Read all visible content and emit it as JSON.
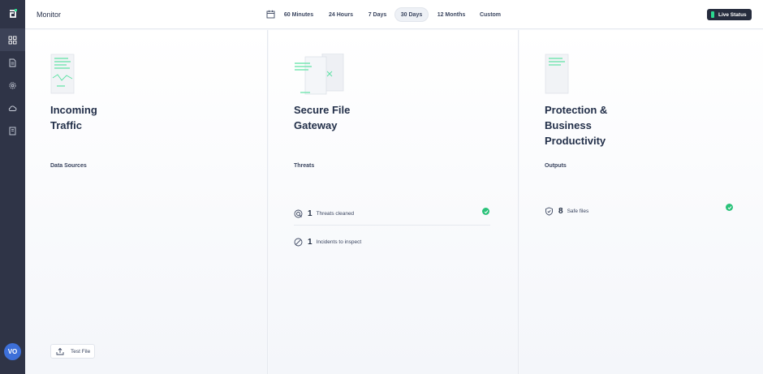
{
  "sidebar": {
    "logo_icon": "logo-icon",
    "items": [
      {
        "icon": "dashboard-grid-icon",
        "active": true
      },
      {
        "icon": "document-icon",
        "active": false
      },
      {
        "icon": "settings-gear-icon",
        "active": false
      },
      {
        "icon": "cloud-icon",
        "active": false
      },
      {
        "icon": "book-icon",
        "active": false
      }
    ],
    "avatar_initials": "VO"
  },
  "header": {
    "title": "Monitor",
    "calendar_icon": "calendar-icon",
    "ranges": [
      {
        "label": "60 Minutes",
        "active": false
      },
      {
        "label": "24 Hours",
        "active": false
      },
      {
        "label": "7 Days",
        "active": false
      },
      {
        "label": "30 Days",
        "active": true
      },
      {
        "label": "12 Months",
        "active": false
      },
      {
        "label": "Custom",
        "active": false
      }
    ],
    "live_status_label": "Live Status"
  },
  "columns": {
    "incoming": {
      "title_line1": "Incoming",
      "title_line2": "Traffic",
      "section": "Data Sources",
      "test_file_label": "Test File"
    },
    "gateway": {
      "title_line1": "Secure File",
      "title_line2": "Gateway",
      "section": "Threats",
      "stats": [
        {
          "value": "1",
          "label": "Threats cleaned",
          "icon": "virus-scan-icon"
        },
        {
          "value": "1",
          "label": "Incidents to inspect",
          "icon": "blocked-icon"
        }
      ]
    },
    "protection": {
      "title_line1": "Protection &",
      "title_line2": "Business",
      "title_line3": "Productivity",
      "section": "Outputs",
      "stats": [
        {
          "value": "8",
          "label": "Safe files",
          "icon": "shield-check-icon"
        }
      ]
    }
  },
  "colors": {
    "sidebar": "#2f3447",
    "accent_green": "#2bc27a",
    "avatar": "#3d6fd8",
    "live_button": "#262c3d"
  }
}
